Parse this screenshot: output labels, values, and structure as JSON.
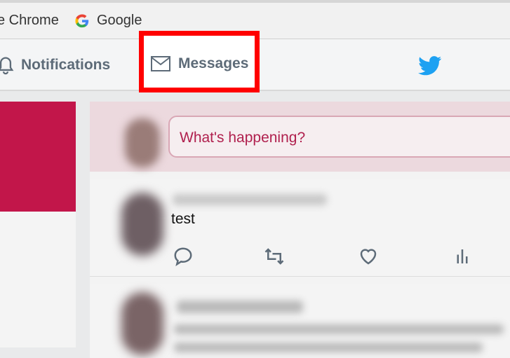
{
  "bookmarks": {
    "items": [
      {
        "label": "e Chrome"
      },
      {
        "label": "Google",
        "icon": "google-g-icon"
      }
    ]
  },
  "nav": {
    "notifications_label": "Notifications",
    "messages_label": "Messages",
    "highlight_color": "#ff0000",
    "brand_color": "#1da1f2"
  },
  "compose": {
    "placeholder": "What's happening?"
  },
  "timeline": {
    "tweet": {
      "text": "test",
      "actions": [
        "reply-icon",
        "retweet-icon",
        "like-icon",
        "analytics-icon"
      ]
    }
  },
  "theme": {
    "accent": "#c2164a"
  }
}
